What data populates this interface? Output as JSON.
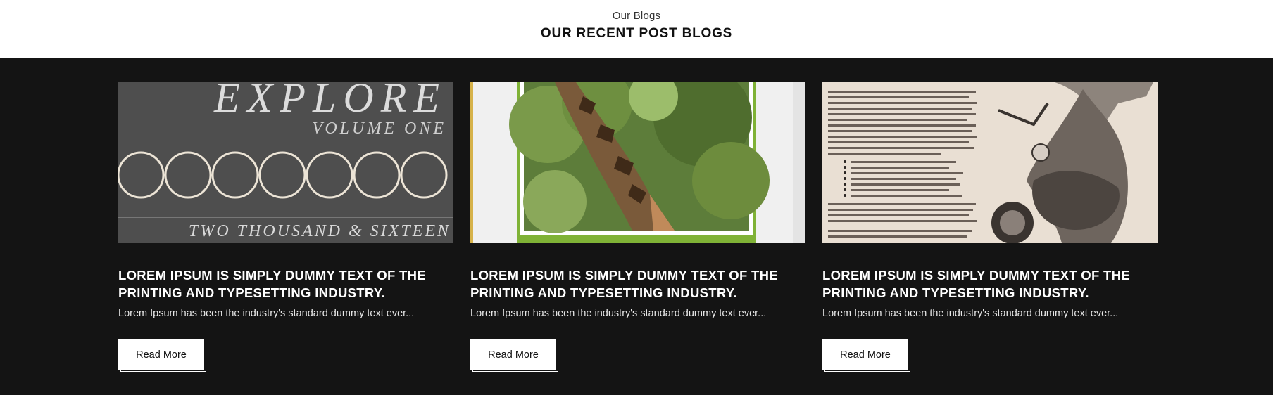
{
  "header": {
    "eyebrow": "Our Blogs",
    "title": "OUR RECENT POST BLOGS"
  },
  "posts": [
    {
      "title": "LOREM IPSUM IS SIMPLY DUMMY TEXT OF THE PRINTING AND TYPESETTING INDUSTRY.",
      "excerpt": "Lorem Ipsum has been the industry's standard dummy text ever...",
      "button": "Read More",
      "image": {
        "line1": "EXPLORE",
        "line2": "VOLUME ONE",
        "line3": "TWO THOUSAND & SIXTEEN"
      }
    },
    {
      "title": "LOREM IPSUM IS SIMPLY DUMMY TEXT OF THE PRINTING AND TYPESETTING INDUSTRY.",
      "excerpt": "Lorem Ipsum has been the industry's standard dummy text ever...",
      "button": "Read More"
    },
    {
      "title": "LOREM IPSUM IS SIMPLY DUMMY TEXT OF THE PRINTING AND TYPESETTING INDUSTRY.",
      "excerpt": "Lorem Ipsum has been the industry's standard dummy text ever...",
      "button": "Read More"
    }
  ],
  "colors": {
    "section_bg": "#141414",
    "header_bg": "#ffffff",
    "title_text": "#ffffff",
    "button_bg": "#ffffff"
  }
}
